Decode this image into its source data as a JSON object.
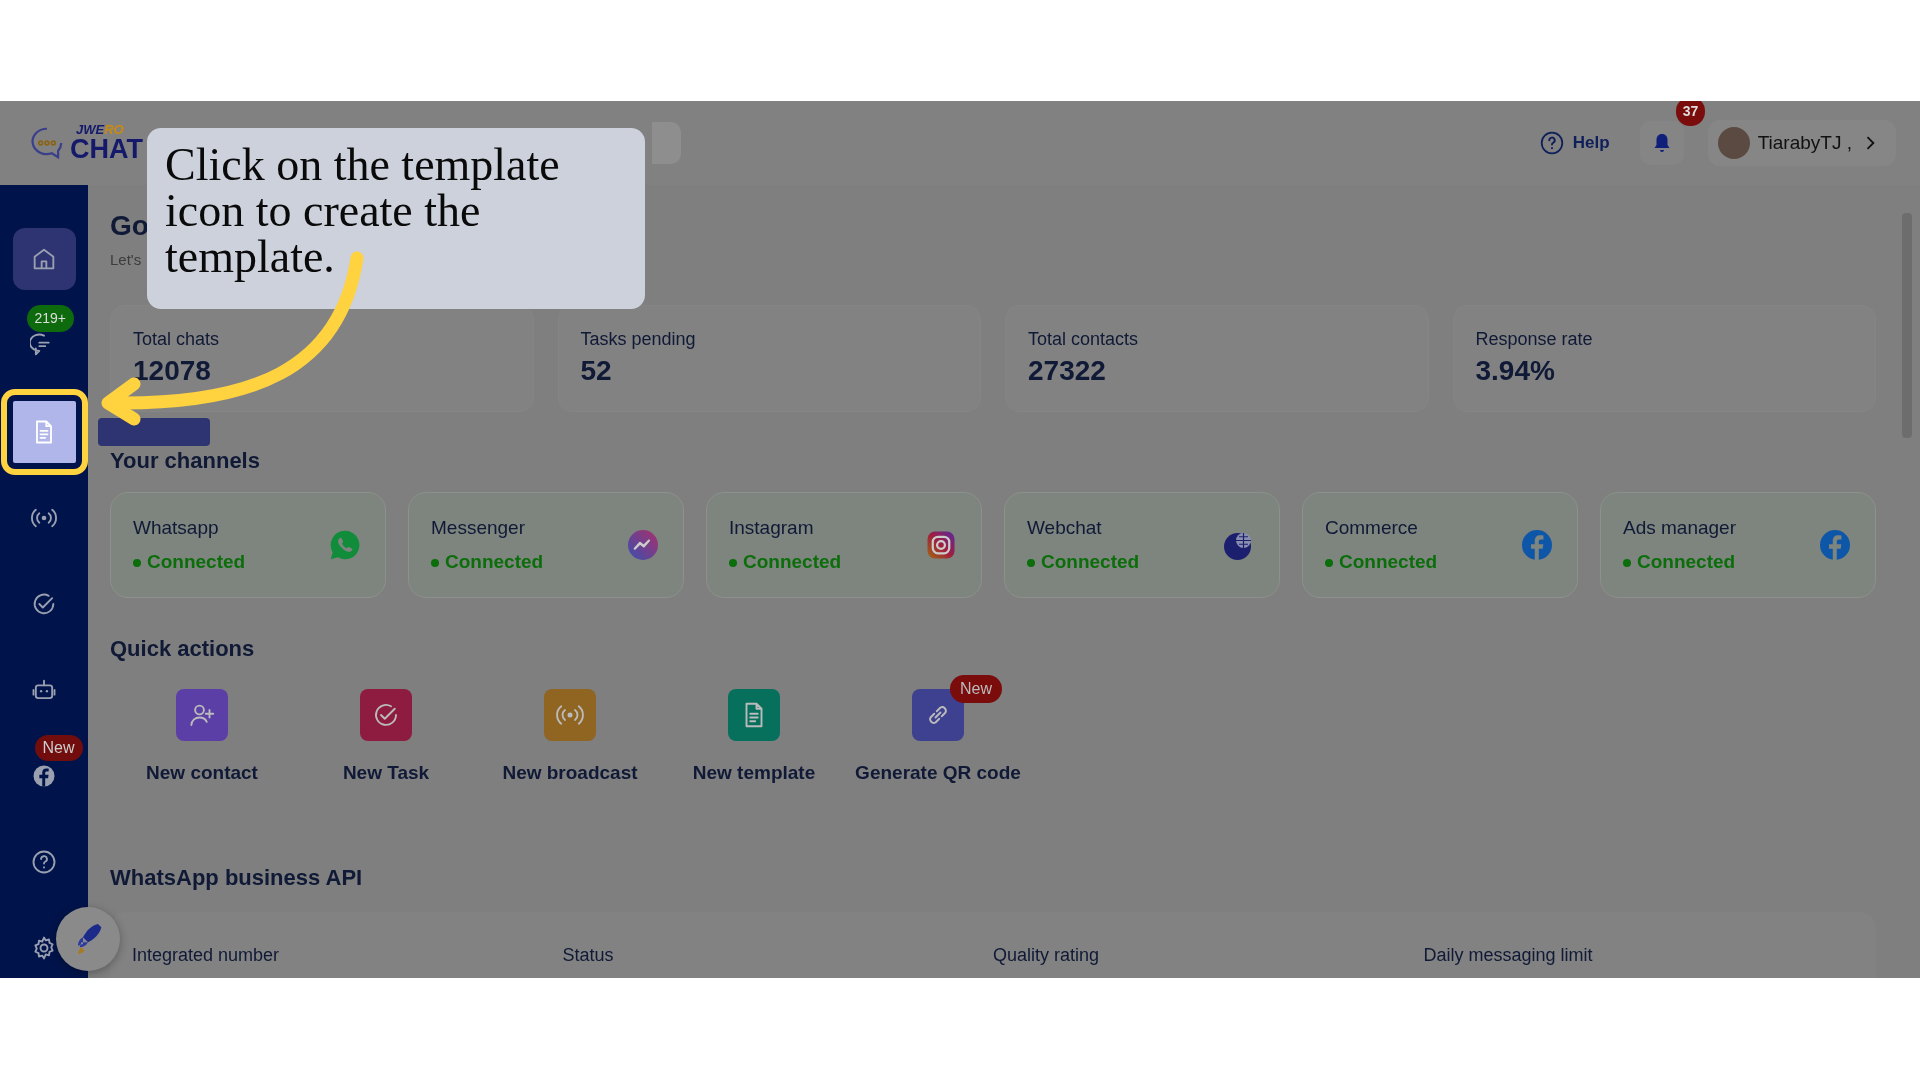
{
  "header": {
    "logo": {
      "brand": "JWE",
      "brand_accent": "RO",
      "product": "CHAT"
    },
    "help": "Help",
    "notifications": {
      "count": "37"
    },
    "user": {
      "name": "TiarabyTJ ,"
    }
  },
  "sidebar": {
    "items": [
      {
        "kind": "home",
        "selected": true,
        "highlighted": false
      },
      {
        "kind": "chats",
        "selected": false,
        "highlighted": false,
        "badge": "219+"
      },
      {
        "kind": "templates",
        "selected": false,
        "highlighted": true
      },
      {
        "kind": "broadcast",
        "selected": false,
        "highlighted": false
      },
      {
        "kind": "tasks",
        "selected": false,
        "highlighted": false
      },
      {
        "kind": "bot",
        "selected": false,
        "highlighted": false
      },
      {
        "kind": "facebook",
        "selected": false,
        "highlighted": false,
        "badge": "New"
      },
      {
        "kind": "help",
        "selected": false,
        "highlighted": false
      },
      {
        "kind": "settings",
        "selected": false,
        "highlighted": false
      }
    ]
  },
  "greeting": {
    "title": "Go",
    "subtitle": "Let's"
  },
  "stats": [
    {
      "label": "Total chats",
      "value": "12078"
    },
    {
      "label": "Tasks pending",
      "value": "52"
    },
    {
      "label": "Total contacts",
      "value": "27322"
    },
    {
      "label": "Response rate",
      "value": "3.94%"
    }
  ],
  "channels": {
    "title": "Your channels",
    "items": [
      {
        "name": "Whatsapp",
        "status": "Connected",
        "kind": "whatsapp"
      },
      {
        "name": "Messenger",
        "status": "Connected",
        "kind": "messenger"
      },
      {
        "name": "Instagram",
        "status": "Connected",
        "kind": "instagram"
      },
      {
        "name": "Webchat",
        "status": "Connected",
        "kind": "webchat"
      },
      {
        "name": "Commerce",
        "status": "Connected",
        "kind": "facebook"
      },
      {
        "name": "Ads manager",
        "status": "Connected",
        "kind": "facebook"
      }
    ]
  },
  "quick_actions": {
    "title": "Quick actions",
    "items": [
      {
        "label": "New contact",
        "kind": "contact",
        "color": "#5b3fa6"
      },
      {
        "label": "New Task",
        "kind": "task",
        "color": "#8e1b40"
      },
      {
        "label": "New broadcast",
        "kind": "broadcast",
        "color": "#8f6521"
      },
      {
        "label": "New template",
        "kind": "template",
        "color": "#07705d"
      },
      {
        "label": "Generate QR code",
        "kind": "link",
        "color": "#3d4190",
        "badge": "New"
      }
    ]
  },
  "whatsapp_api": {
    "title": "WhatsApp business API",
    "columns": [
      "Integrated number",
      "Status",
      "Quality rating",
      "Daily messaging limit"
    ]
  },
  "callout": {
    "text": "Click on the template icon to create the template."
  }
}
